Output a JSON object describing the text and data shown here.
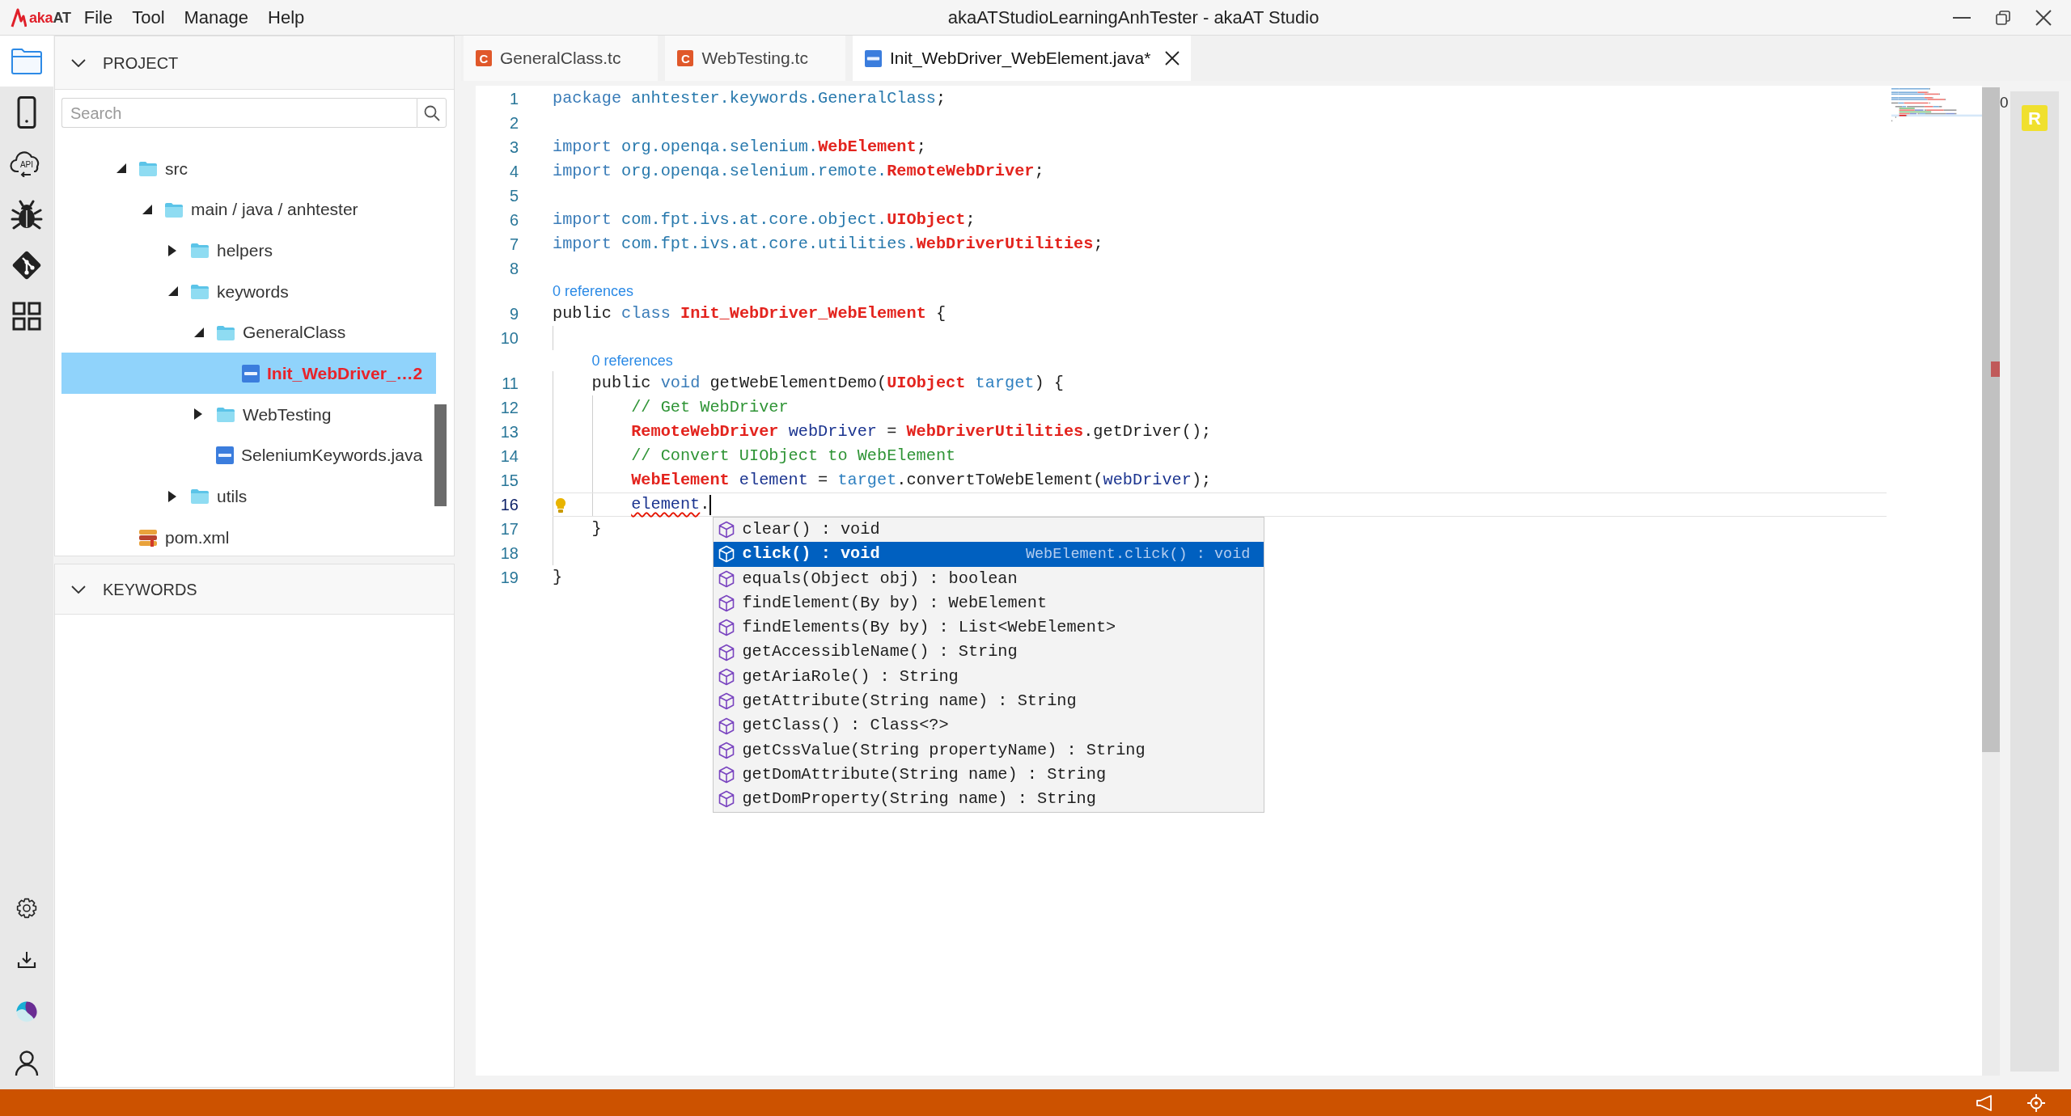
{
  "title_bar": {
    "logo_text": [
      "aka",
      "AT"
    ],
    "menu": [
      "File",
      "Tool",
      "Manage",
      "Help"
    ],
    "title": "akaATStudioLearningAnhTester - akaAT Studio"
  },
  "activity_bar": {
    "items": [
      {
        "selected": true
      },
      {
        "selected": false
      },
      {
        "selected": false,
        "label": "API"
      },
      {
        "selected": false
      },
      {
        "selected": false
      },
      {
        "selected": false
      }
    ]
  },
  "sidebar": {
    "panels": [
      {
        "title": "PROJECT",
        "expanded": true,
        "search": {
          "placeholder": "Search"
        },
        "tree": [
          {
            "label": "src",
            "kind": "folder",
            "expanded": true,
            "selected": false,
            "error": false,
            "children": [
              {
                "label": "main / java / anhtester",
                "kind": "folder",
                "expanded": true,
                "selected": false,
                "error": false,
                "children": [
                  {
                    "label": "helpers",
                    "kind": "folder",
                    "expanded": false,
                    "selected": false,
                    "error": false
                  },
                  {
                    "label": "keywords",
                    "kind": "folder",
                    "expanded": true,
                    "selected": false,
                    "error": false,
                    "children": [
                      {
                        "label": "GeneralClass",
                        "kind": "folder",
                        "expanded": true,
                        "selected": false,
                        "error": false,
                        "children": [
                          {
                            "label": "Init_WebDriver_…2",
                            "kind": "java",
                            "selected": true,
                            "error": true
                          }
                        ]
                      },
                      {
                        "label": "WebTesting",
                        "kind": "folder",
                        "expanded": false,
                        "selected": false,
                        "error": false
                      },
                      {
                        "label": "SeleniumKeywords.java",
                        "kind": "java",
                        "selected": false,
                        "error": false
                      }
                    ]
                  },
                  {
                    "label": "utils",
                    "kind": "folder",
                    "expanded": false,
                    "selected": false,
                    "error": false
                  }
                ]
              }
            ]
          },
          {
            "label": "pom.xml",
            "kind": "xml",
            "selected": false,
            "error": false
          }
        ]
      },
      {
        "title": "KEYWORDS",
        "expanded": true
      }
    ]
  },
  "editor": {
    "tabs": [
      {
        "label": "GeneralClass.tc",
        "kind": "testcase",
        "icon_letter": "C",
        "selected": false
      },
      {
        "label": "WebTesting.tc",
        "kind": "testcase",
        "icon_letter": "C",
        "selected": false
      },
      {
        "label": "Init_WebDriver_WebElement.java*",
        "kind": "java",
        "selected": true
      }
    ],
    "lines": [
      {
        "kind": "code",
        "number": "1",
        "current": false,
        "tokens": [
          {
            "kind": "keyword",
            "text": "package "
          },
          {
            "kind": "namespace",
            "text": "anhtester.keywords.GeneralClass"
          },
          {
            "kind": "plain",
            "text": ";"
          }
        ]
      },
      {
        "kind": "code",
        "number": "2",
        "current": false
      },
      {
        "kind": "code",
        "number": "3",
        "current": false,
        "tokens": [
          {
            "kind": "keyword",
            "text": "import "
          },
          {
            "kind": "namespace",
            "text": "org.openqa.selenium."
          },
          {
            "kind": "type",
            "text": "WebElement"
          },
          {
            "kind": "plain",
            "text": ";"
          }
        ]
      },
      {
        "kind": "code",
        "number": "4",
        "current": false,
        "tokens": [
          {
            "kind": "keyword",
            "text": "import "
          },
          {
            "kind": "namespace",
            "text": "org.openqa.selenium.remote."
          },
          {
            "kind": "type",
            "text": "RemoteWebDriver"
          },
          {
            "kind": "plain",
            "text": ";"
          }
        ]
      },
      {
        "kind": "code",
        "number": "5",
        "current": false
      },
      {
        "kind": "code",
        "number": "6",
        "current": false,
        "tokens": [
          {
            "kind": "keyword",
            "text": "import "
          },
          {
            "kind": "namespace",
            "text": "com.fpt.ivs.at.core.object."
          },
          {
            "kind": "type",
            "text": "UIObject"
          },
          {
            "kind": "plain",
            "text": ";"
          }
        ]
      },
      {
        "kind": "code",
        "number": "7",
        "current": false,
        "tokens": [
          {
            "kind": "keyword",
            "text": "import "
          },
          {
            "kind": "namespace",
            "text": "com.fpt.ivs.at.core.utilities."
          },
          {
            "kind": "type",
            "text": "WebDriverUtilities"
          },
          {
            "kind": "plain",
            "text": ";"
          }
        ]
      },
      {
        "kind": "code",
        "number": "8",
        "current": false
      },
      {
        "kind": "codelens",
        "text": "0 references"
      },
      {
        "kind": "code",
        "number": "9",
        "current": false,
        "tokens": [
          {
            "kind": "plain",
            "text": "public "
          },
          {
            "kind": "keyword",
            "text": "class "
          },
          {
            "kind": "type",
            "text": "Init_WebDriver_WebElement"
          },
          {
            "kind": "plain",
            "text": " {"
          }
        ]
      },
      {
        "kind": "code",
        "number": "10",
        "current": false
      },
      {
        "kind": "codelens",
        "text": "0 references"
      },
      {
        "kind": "code",
        "number": "11",
        "current": false,
        "tokens": [
          {
            "kind": "plain",
            "text": "    public "
          },
          {
            "kind": "keyword",
            "text": "void"
          },
          {
            "kind": "plain",
            "text": " getWebElementDemo("
          },
          {
            "kind": "type",
            "text": "UIObject "
          },
          {
            "kind": "parameter",
            "text": "target"
          },
          {
            "kind": "plain",
            "text": ") {"
          }
        ]
      },
      {
        "kind": "code",
        "number": "12",
        "current": false,
        "tokens": [
          {
            "kind": "comment",
            "text": "        // Get WebDriver"
          }
        ]
      },
      {
        "kind": "code",
        "number": "13",
        "current": false,
        "tokens": [
          {
            "kind": "type",
            "text": "        RemoteWebDriver "
          },
          {
            "kind": "variable",
            "text": "webDriver"
          },
          {
            "kind": "plain",
            "text": " = "
          },
          {
            "kind": "type",
            "text": "WebDriverUtilities"
          },
          {
            "kind": "plain",
            "text": ".getDriver();"
          }
        ]
      },
      {
        "kind": "code",
        "number": "14",
        "current": false,
        "tokens": [
          {
            "kind": "comment",
            "text": "        // Convert UIObject to WebElement"
          }
        ]
      },
      {
        "kind": "code",
        "number": "15",
        "current": false,
        "tokens": [
          {
            "kind": "type",
            "text": "        WebElement "
          },
          {
            "kind": "variable",
            "text": "element"
          },
          {
            "kind": "plain",
            "text": " = "
          },
          {
            "kind": "parameter",
            "text": "target"
          },
          {
            "kind": "plain",
            "text": ".convertToWebElement("
          },
          {
            "kind": "variable",
            "text": "webDriver"
          },
          {
            "kind": "plain",
            "text": ");"
          }
        ]
      },
      {
        "kind": "code",
        "number": "16",
        "current": true,
        "tokens": [
          {
            "kind": "error",
            "text": "        element"
          },
          {
            "kind": "plain",
            "text": "."
          }
        ]
      },
      {
        "kind": "code",
        "number": "17",
        "current": false,
        "tokens": [
          {
            "kind": "plain",
            "text": "    }"
          }
        ]
      },
      {
        "kind": "code",
        "number": "18",
        "current": false
      },
      {
        "kind": "code",
        "number": "19",
        "current": false,
        "tokens": [
          {
            "kind": "plain",
            "text": "}"
          }
        ]
      }
    ],
    "completion": {
      "items": [
        {
          "label": "clear() : void",
          "selected": false
        },
        {
          "label": "click() : void",
          "selected": true,
          "detail": "WebElement.click() : void"
        },
        {
          "label": "equals(Object obj) : boolean",
          "selected": false
        },
        {
          "label": "findElement(By by) : WebElement",
          "selected": false
        },
        {
          "label": "findElements(By by) : List<WebElement>",
          "selected": false
        },
        {
          "label": "getAccessibleName() : String",
          "selected": false
        },
        {
          "label": "getAriaRole() : String",
          "selected": false
        },
        {
          "label": "getAttribute(String name) : String",
          "selected": false
        },
        {
          "label": "getClass() : Class<?>",
          "selected": false
        },
        {
          "label": "getCssValue(String propertyName) : String",
          "selected": false
        },
        {
          "label": "getDomAttribute(String name) : String",
          "selected": false
        },
        {
          "label": "getDomProperty(String name) : String",
          "selected": false
        }
      ]
    }
  },
  "overview_ruler": {
    "counter": "0",
    "badge": "R"
  }
}
